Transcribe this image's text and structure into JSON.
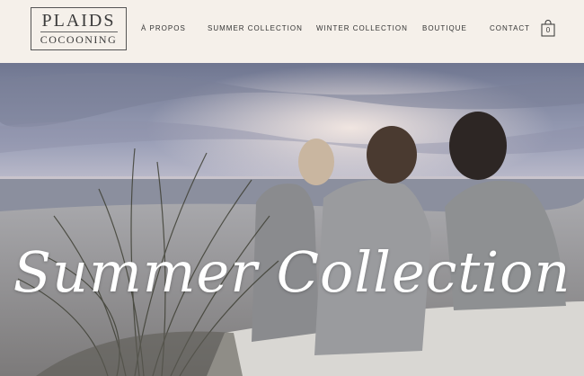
{
  "logo": {
    "line1": "PLAIDS",
    "line2": "COCOONING"
  },
  "nav": {
    "items": [
      {
        "label": "À PROPOS"
      },
      {
        "label": "SUMMER COLLECTION"
      },
      {
        "label": "WINTER COLLECTION"
      },
      {
        "label": "BOUTIQUE"
      },
      {
        "label": "CONTACT"
      }
    ]
  },
  "cart": {
    "count": "0",
    "icon": "shopping-bag-icon"
  },
  "hero": {
    "title": "Summer Collection"
  },
  "colors": {
    "header_bg": "#f5f0ea",
    "text": "#333333",
    "hero_title": "#ffffff"
  }
}
